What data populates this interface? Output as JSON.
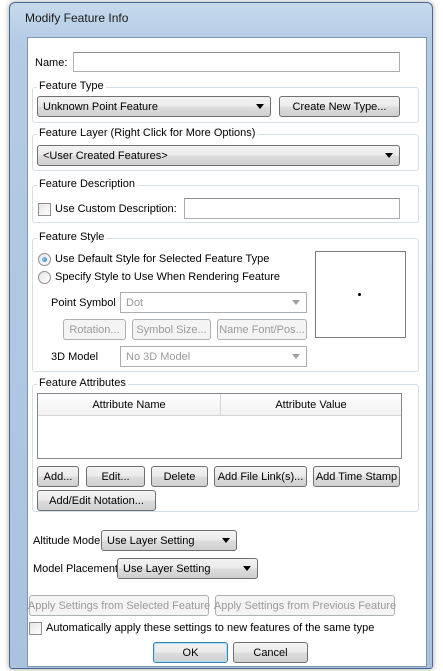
{
  "window": {
    "title": "Modify Feature Info"
  },
  "name_field": {
    "label": "Name:",
    "value": ""
  },
  "feature_type": {
    "group_title": "Feature Type",
    "selected": "Unknown Point Feature",
    "create_button": "Create New Type..."
  },
  "feature_layer": {
    "group_title": "Feature Layer (Right Click for More Options)",
    "selected": "<User Created Features>"
  },
  "feature_description": {
    "group_title": "Feature Description",
    "checkbox_label": "Use Custom Description:",
    "value": ""
  },
  "feature_style": {
    "group_title": "Feature Style",
    "radio_default": "Use Default Style for Selected Feature Type",
    "radio_specify": "Specify Style to Use When Rendering Feature",
    "point_symbol_label": "Point Symbol",
    "point_symbol_value": "Dot",
    "rotation_button": "Rotation...",
    "symbol_size_button": "Symbol Size...",
    "name_font_button": "Name Font/Pos...",
    "model_label": "3D Model",
    "model_value": "No 3D Model"
  },
  "feature_attributes": {
    "group_title": "Feature Attributes",
    "columns": [
      "Attribute Name",
      "Attribute Value"
    ],
    "rows": [],
    "add_button": "Add...",
    "edit_button": "Edit...",
    "delete_button": "Delete",
    "add_file_link_button": "Add File Link(s)...",
    "add_time_stamp_button": "Add Time Stamp",
    "notation_button": "Add/Edit Notation..."
  },
  "altitude_mode": {
    "label": "Altitude Mode:",
    "value": "Use Layer Setting"
  },
  "model_placement": {
    "label": "Model Placement:",
    "value": "Use Layer Setting"
  },
  "apply_selected_button": "Apply Settings from Selected Feature",
  "apply_previous_button": "Apply Settings from Previous Feature",
  "auto_apply_label": "Automatically apply these settings to new features of the same type",
  "ok_button": "OK",
  "cancel_button": "Cancel"
}
